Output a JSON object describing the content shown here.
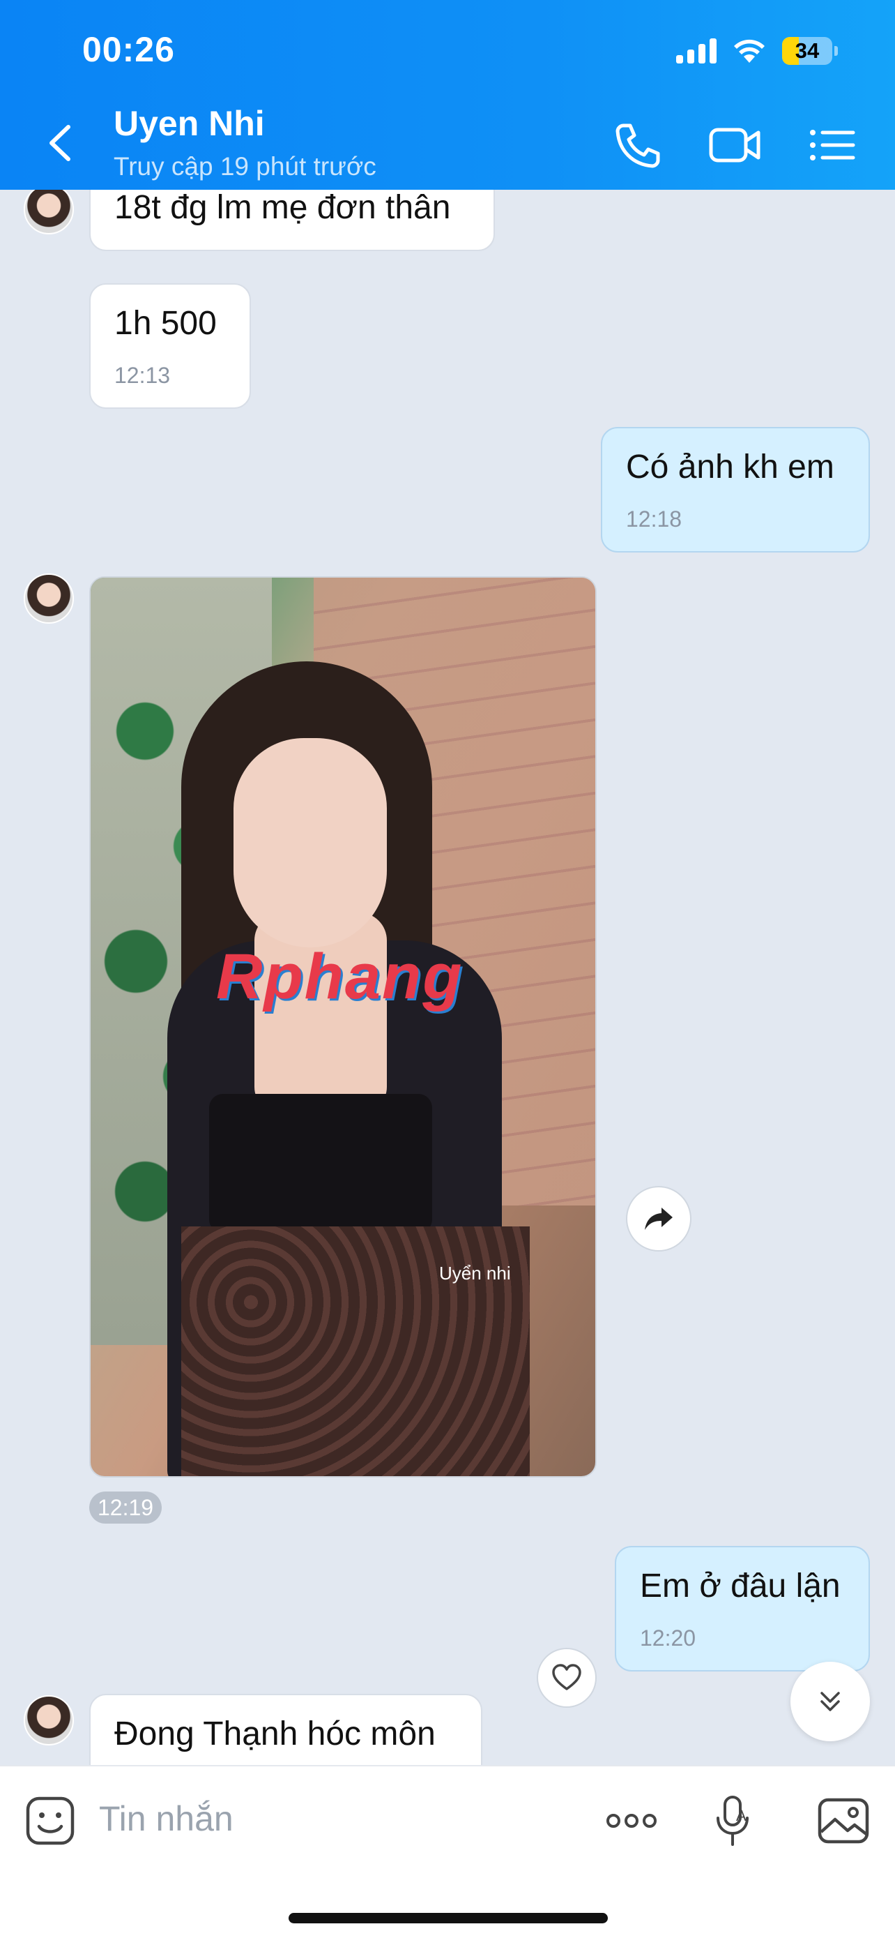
{
  "status_bar": {
    "time": "00:26",
    "battery_level": "34",
    "battery_color": "#ffd60a"
  },
  "header": {
    "name": "Uyen Nhi",
    "status": "Truy cập 19 phút trước",
    "icons": [
      "back-icon",
      "phone-icon",
      "video-call-icon",
      "menu-icon"
    ]
  },
  "messages": [
    {
      "side": "in",
      "text": "18t đg lm mẹ đơn thân"
    },
    {
      "side": "in",
      "text": "1h 500",
      "time": "12:13"
    },
    {
      "side": "out",
      "text": "Có ảnh kh em",
      "time": "12:18"
    },
    {
      "side": "in",
      "type": "photo",
      "watermark": "Rphang",
      "caption": "Uyển nhi",
      "time": "12:19"
    },
    {
      "side": "out",
      "text": "Em ở đâu lận",
      "time": "12:20"
    },
    {
      "side": "in",
      "text": "Đong Thạnh hóc môn"
    }
  ],
  "input": {
    "placeholder": "Tin nhắn"
  },
  "colors": {
    "header_bg": "#0f90f6",
    "chat_bg": "#e2e8f1",
    "outgoing_bubble": "#d5f0ff",
    "incoming_bubble": "#ffffff"
  }
}
